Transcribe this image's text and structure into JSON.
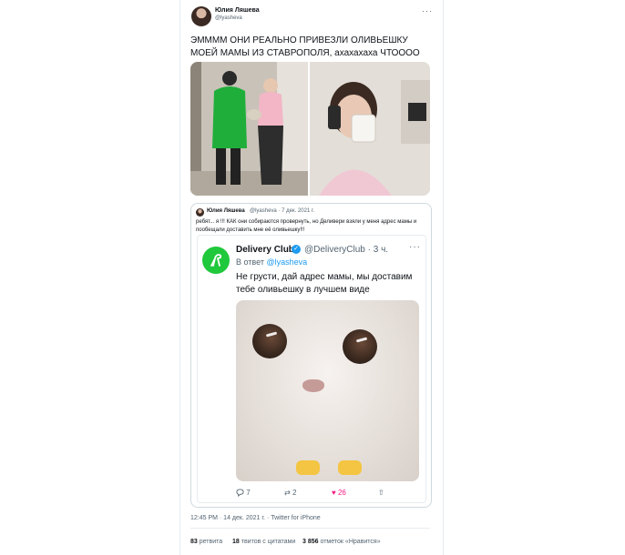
{
  "author": {
    "name": "Юлия Ляшева",
    "handle": "@lyasheva"
  },
  "tweet": {
    "text": "ЭММММ ОНИ РЕАЛЬНО ПРИВЕЗЛИ ОЛИВЬЕШКУ МОЕЙ МАМЫ ИЗ СТАВРОПОЛЯ, ахахахаха ЧТОООО",
    "more": "···"
  },
  "quoted": {
    "name": "Юлия Ляшева",
    "meta": "@lyasheva · 7 дек. 2021 г.",
    "text": "ребят... я !!! КАК они собираются провернуть, но Деливери взяли у меня адрес мамы и пообещали доставить мне её оливьешку!!!"
  },
  "delivery": {
    "name": "Delivery Club",
    "handle": "@DeliveryClub · 3 ч.",
    "reply_prefix": "В ответ",
    "reply_handle": "@lyasheva",
    "text": "Не грусти, дай адрес мамы, мы доставим тебе оливьешку в лучшем виде",
    "more": "···",
    "actions": {
      "replies": "7",
      "retweets": "2",
      "likes": "26"
    },
    "like_color": "#f91880"
  },
  "footer": {
    "time": "12:45 PM · 14 дек. 2021 г. · Twitter for iPhone",
    "retweets_count": "83",
    "retweets_label": "ретвита",
    "quotes_count": "18",
    "quotes_label": "твитов с цитатами",
    "likes_count": "3 856",
    "likes_label": "отметок «Нравится»"
  },
  "colors": {
    "accent": "#1d9bf0",
    "delivery_green": "#20c83b",
    "muted": "#536471"
  }
}
